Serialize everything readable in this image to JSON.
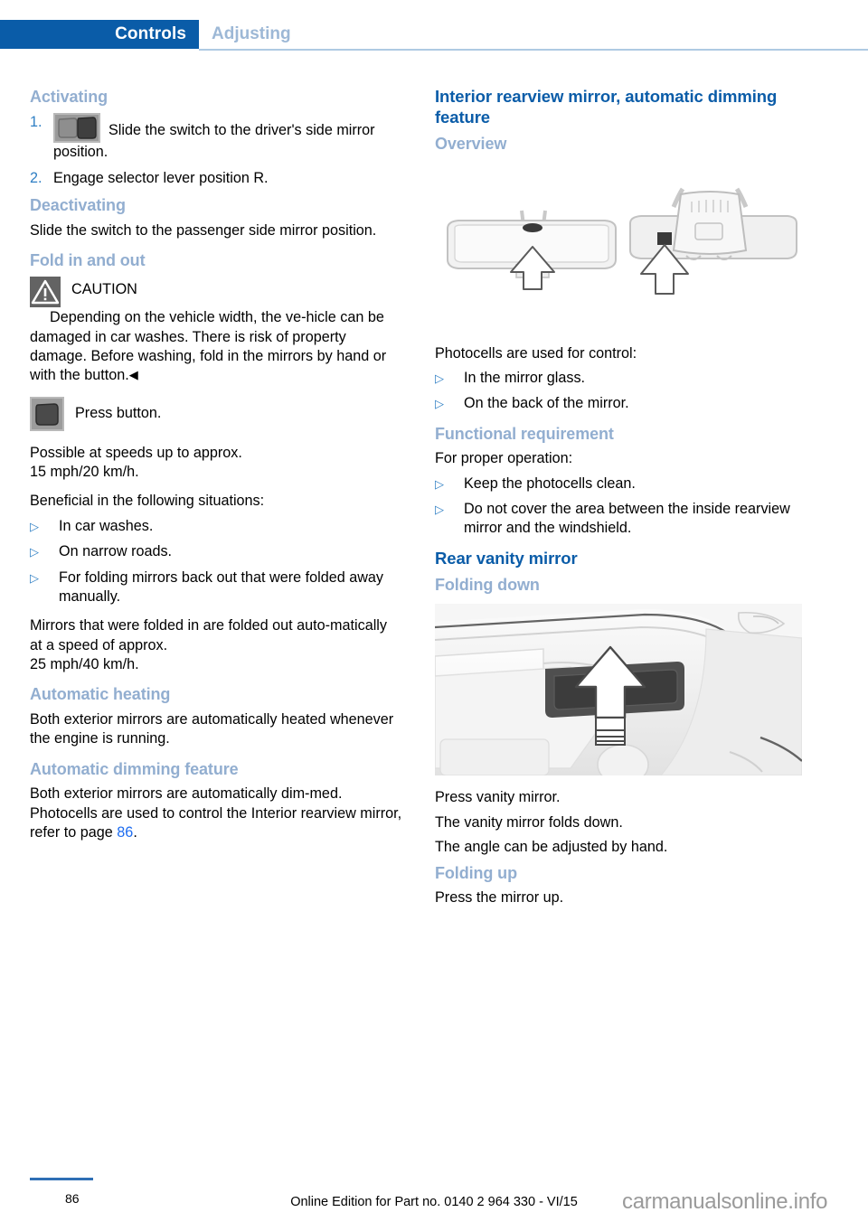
{
  "header": {
    "active_tab": "Controls",
    "inactive_tab": "Adjusting",
    "active_bg": "#0a5ca8",
    "inactive_color": "#9db8d6"
  },
  "left_column": {
    "activating": {
      "heading": "Activating",
      "steps": [
        {
          "num": "1.",
          "text": "Slide the switch to the driver's side mirror position.",
          "icon": "mirror-switch-icon"
        },
        {
          "num": "2.",
          "text": "Engage selector lever position R."
        }
      ]
    },
    "deactivating": {
      "heading": "Deactivating",
      "text": "Slide the switch to the passenger side mirror position."
    },
    "fold_in_and_out": {
      "heading": "Fold in and out",
      "caution_label": "CAUTION",
      "caution_text": "Depending on the vehicle width, the ve-hicle can be damaged in car washes. There is risk of property damage. Before washing, fold in the mirrors by hand or with the button.",
      "caution_endmark": "◀",
      "press_button_label": "Press button.",
      "speed_note": "Possible at speeds up to approx.\n15 mph/20 km/h.",
      "beneficial_intro": "Beneficial in the following situations:",
      "beneficial_items": [
        "In car washes.",
        "On narrow roads.",
        "For folding mirrors back out that were folded away manually."
      ],
      "auto_unfold_note": "Mirrors that were folded in are folded out auto-matically at a speed of approx.\n25 mph/40 km/h."
    },
    "automatic_heating": {
      "heading": "Automatic heating",
      "text": "Both exterior mirrors are automatically heated whenever the engine is running."
    },
    "automatic_dimming": {
      "heading": "Automatic dimming feature",
      "text_before_link": "Both exterior mirrors are automatically dim-med. Photocells are used to control the Interior rearview mirror, refer to page ",
      "page_link": "86",
      "text_after_link": "."
    }
  },
  "right_column": {
    "interior_mirror": {
      "heading": "Interior rearview mirror, automatic dimming feature",
      "overview_heading": "Overview",
      "figure_caption_intro": "Photocells are used for control:",
      "photocell_items": [
        "In the mirror glass.",
        "On the back of the mirror."
      ]
    },
    "functional_requirement": {
      "heading": "Functional requirement",
      "intro": "For proper operation:",
      "items": [
        "Keep the photocells clean.",
        "Do not cover the area between the inside rearview mirror and the windshield."
      ]
    },
    "rear_vanity_mirror": {
      "heading": "Rear vanity mirror",
      "folding_down_heading": "Folding down",
      "folding_down_steps": [
        "Press vanity mirror.",
        "The vanity mirror folds down.",
        "The angle can be adjusted by hand."
      ],
      "folding_up_heading": "Folding up",
      "folding_up_text": "Press the mirror up."
    }
  },
  "footer": {
    "page_number": "86",
    "edition_line": "Online Edition for Part no. 0140 2 964 330 - VI/15",
    "watermark": "carmanualsonline.info"
  }
}
